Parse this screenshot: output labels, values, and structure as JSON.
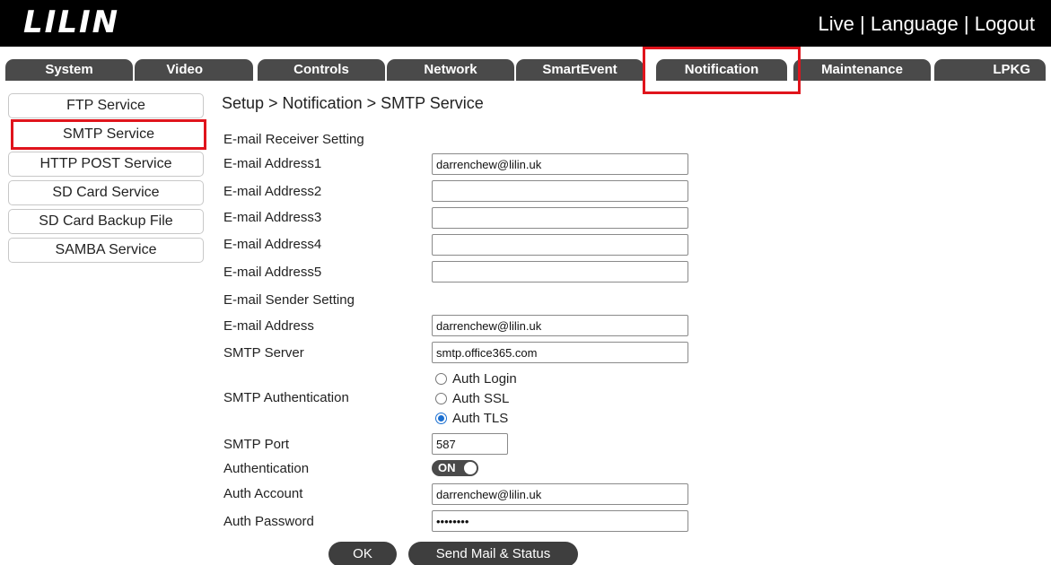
{
  "header": {
    "logo_text": "LILIN",
    "links": [
      "Live",
      "Language",
      "Logout"
    ],
    "separator": " | "
  },
  "tabs": [
    {
      "label": "System"
    },
    {
      "label": "Video"
    },
    {
      "label": "Controls"
    },
    {
      "label": "Network"
    },
    {
      "label": "SmartEvent"
    },
    {
      "label": "Notification",
      "active": true
    },
    {
      "label": "Maintenance"
    },
    {
      "label": "LPKG"
    }
  ],
  "sidebar": {
    "items": [
      {
        "label": "FTP Service"
      },
      {
        "label": "SMTP Service",
        "active": true
      },
      {
        "label": "HTTP POST Service"
      },
      {
        "label": "SD Card Service"
      },
      {
        "label": "SD Card Backup File"
      },
      {
        "label": "SAMBA Service"
      }
    ]
  },
  "breadcrumb": "Setup > Notification > SMTP Service",
  "receiver": {
    "section_label": "E-mail Receiver Setting",
    "fields": [
      {
        "label": "E-mail Address1",
        "value": "darrenchew@lilin.uk"
      },
      {
        "label": "E-mail Address2",
        "value": ""
      },
      {
        "label": "E-mail Address3",
        "value": ""
      },
      {
        "label": "E-mail Address4",
        "value": ""
      },
      {
        "label": "E-mail Address5",
        "value": ""
      }
    ]
  },
  "sender": {
    "section_label": "E-mail Sender Setting",
    "email_label": "E-mail Address",
    "email_value": "darrenchew@lilin.uk",
    "server_label": "SMTP Server",
    "server_value": "smtp.office365.com",
    "auth_method_label": "SMTP Authentication",
    "auth_options": [
      {
        "label": "Auth Login",
        "checked": false
      },
      {
        "label": "Auth SSL",
        "checked": false
      },
      {
        "label": "Auth TLS",
        "checked": true
      }
    ],
    "port_label": "SMTP Port",
    "port_value": "587",
    "authentication_label": "Authentication",
    "authentication_state": "ON",
    "account_label": "Auth Account",
    "account_value": "darrenchew@lilin.uk",
    "password_label": "Auth Password",
    "password_value": "12345678"
  },
  "buttons": {
    "ok_label": "OK",
    "send_label": "Send Mail & Status"
  },
  "colors": {
    "highlight": "#e0141c",
    "tab_bg": "#4a4a4a",
    "header_bg": "#000000",
    "radio_checked": "#1a6fd1"
  }
}
